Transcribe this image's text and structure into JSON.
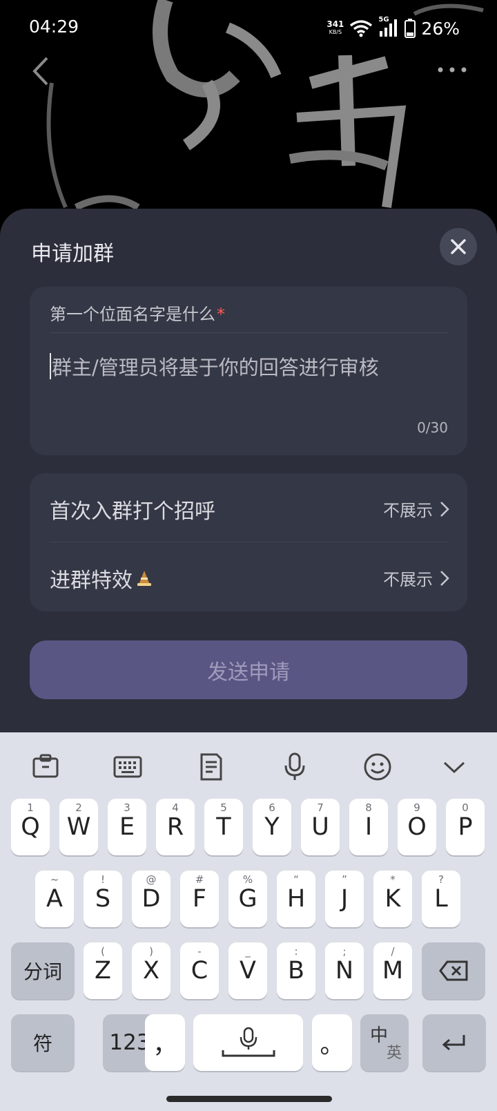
{
  "status_bar": {
    "time": "04:29",
    "net_speed_value": "341",
    "net_speed_unit": "KB/S",
    "network_type": "5G",
    "battery": "26%"
  },
  "sheet": {
    "title": "申请加群",
    "question_label": "第一个位面名字是什么",
    "required_mark": "*",
    "answer_placeholder": "群主/管理员将基于你的回答进行审核",
    "char_count": "0/30",
    "options": [
      {
        "label": "首次入群打个招呼",
        "value": "不展示"
      },
      {
        "label": "进群特效",
        "value": "不展示"
      }
    ],
    "submit_label": "发送申请"
  },
  "keyboard": {
    "toolbar_icons": [
      "clipboard-icon",
      "keyboard-icon",
      "document-icon",
      "microphone-icon",
      "emoji-icon",
      "chevron-down-icon"
    ],
    "row1": [
      {
        "main": "Q",
        "sub": "1"
      },
      {
        "main": "W",
        "sub": "2"
      },
      {
        "main": "E",
        "sub": "3"
      },
      {
        "main": "R",
        "sub": "4"
      },
      {
        "main": "T",
        "sub": "5"
      },
      {
        "main": "Y",
        "sub": "6"
      },
      {
        "main": "U",
        "sub": "7"
      },
      {
        "main": "I",
        "sub": "8"
      },
      {
        "main": "O",
        "sub": "9"
      },
      {
        "main": "P",
        "sub": "0"
      }
    ],
    "row2": [
      {
        "main": "A",
        "sub": "~"
      },
      {
        "main": "S",
        "sub": "!"
      },
      {
        "main": "D",
        "sub": "@"
      },
      {
        "main": "F",
        "sub": "#"
      },
      {
        "main": "G",
        "sub": "%"
      },
      {
        "main": "H",
        "sub": "“"
      },
      {
        "main": "J",
        "sub": "”"
      },
      {
        "main": "K",
        "sub": "*"
      },
      {
        "main": "L",
        "sub": "?"
      }
    ],
    "row3": [
      {
        "main": "Z",
        "sub": "("
      },
      {
        "main": "X",
        "sub": ")"
      },
      {
        "main": "C",
        "sub": "-"
      },
      {
        "main": "V",
        "sub": "_"
      },
      {
        "main": "B",
        "sub": ":"
      },
      {
        "main": "N",
        "sub": ";"
      },
      {
        "main": "M",
        "sub": "/"
      }
    ],
    "segment_key": "分词",
    "symbol_key": "符",
    "number_key": "123",
    "comma_key": "，",
    "period_key": "。",
    "lang_key_top": "中",
    "lang_key_bottom": "英"
  }
}
